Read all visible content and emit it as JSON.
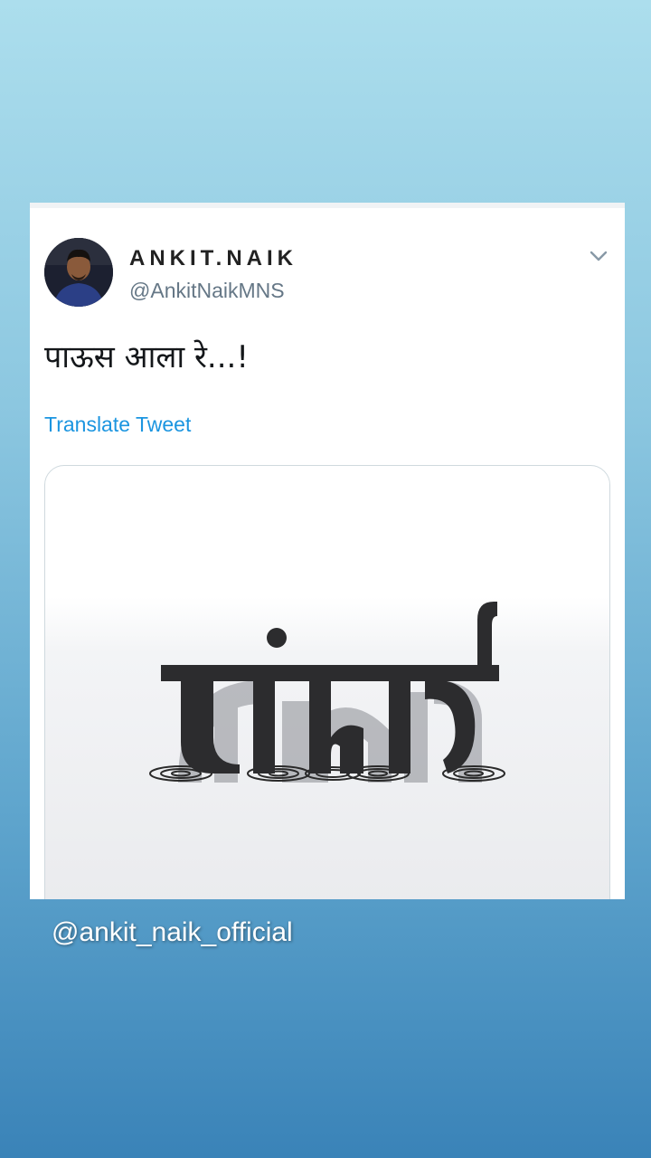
{
  "tweet": {
    "display_name": "ANKIT.NAIK",
    "handle": "@AnkitNaikMNS",
    "text": "पाऊस आला रे...!",
    "translate_label": "Translate Tweet",
    "image_text": "मुंबई"
  },
  "icons": {
    "avatar": "profile-photo",
    "menu": "chevron-down-icon"
  },
  "overlay": {
    "username": "@ankit_naik_official"
  },
  "colors": {
    "link": "#1b95e0",
    "handle": "#657786",
    "background_top": "#acdeed",
    "background_bottom": "#3a83b8"
  }
}
